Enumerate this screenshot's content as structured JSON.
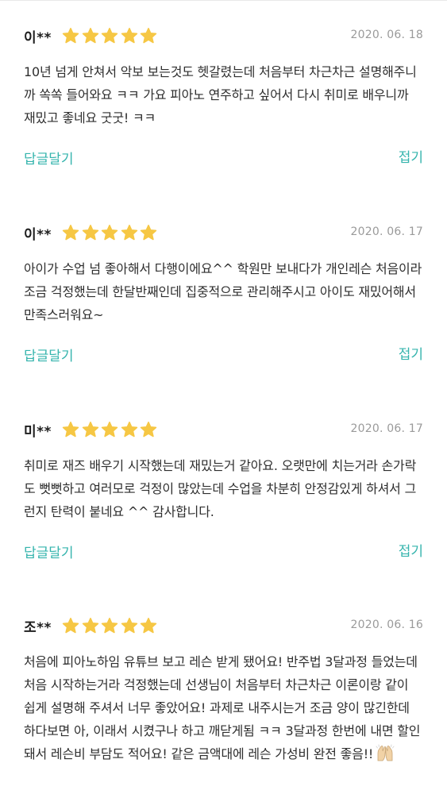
{
  "colors": {
    "accent": "#35b4ad",
    "star": "#f6c744",
    "date": "#9a9a9a",
    "text": "#2e2e2e"
  },
  "reviews": [
    {
      "author": "이**",
      "rating": 5,
      "date": "2020. 06. 18",
      "text": "10년 넘게 안쳐서 악보 보는것도 헷갈렸는데 처음부터 차근차근 설명해주니까 쏙쏙 들어와요 ㅋㅋ 가요 피아노 연주하고 싶어서 다시 취미로 배우니까 재밌고 좋네요 굿굿! ㅋㅋ",
      "reply_label": "답글달기",
      "fold_label": "접기"
    },
    {
      "author": "이**",
      "rating": 5,
      "date": "2020. 06. 17",
      "text": "아이가 수업 넘 좋아해서 다행이에요^^ 학원만 보내다가 개인레슨 처음이라 조금 걱정했는데 한달반째인데 집중적으로 관리해주시고 아이도 재밌어해서 만족스러워요~",
      "reply_label": "답글달기",
      "fold_label": "접기"
    },
    {
      "author": "미**",
      "rating": 5,
      "date": "2020. 06. 17",
      "text": "취미로 재즈 배우기 시작했는데 재밌는거 같아요. 오랫만에 치는거라 손가락도 뻣뻣하고 여러모로 걱정이 많았는데 수업을 차분히 안정감있게 하셔서 그런지 탄력이 붙네요 ^^ 감사합니다.",
      "reply_label": "답글달기",
      "fold_label": "접기"
    },
    {
      "author": "조**",
      "rating": 5,
      "date": "2020. 06. 16",
      "text": "처음에 피아노하임 유튜브 보고 레슨 받게 됐어요! 반주법 3달과정 들었는데 처음 시작하는거라 걱정했는데 선생님이 처음부터 차근차근 이론이랑 같이 쉽게 설명해 주셔서 너무 좋았어요! 과제로 내주시는거 조금 양이 많긴한데 하다보면 아, 이래서 시켰구나 하고 깨닫게됨 ㅋㅋ 3달과정 한번에 내면 할인돼서 레슨비 부담도 적어요! 같은 금액대에 레슨 가성비 완전 좋음!!",
      "emoji_icon": "raising-hands-icon"
    }
  ]
}
